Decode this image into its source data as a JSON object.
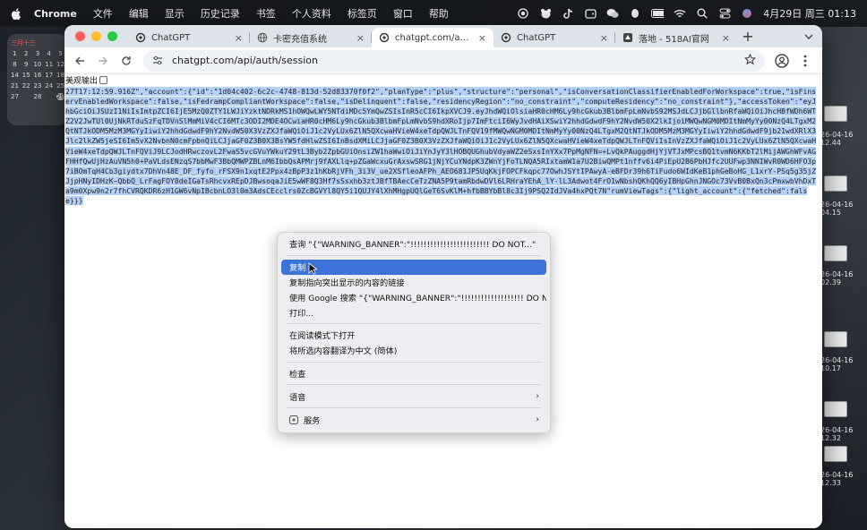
{
  "menubar": {
    "app": "Chrome",
    "items": [
      "文件",
      "编辑",
      "显示",
      "历史记录",
      "书签",
      "个人资料",
      "标签页",
      "窗口",
      "帮助"
    ],
    "clock": "4月29日 周三  01:13"
  },
  "calendar": {
    "header": "三月十三",
    "rows": [
      [
        "1",
        "2",
        "3",
        "4",
        "5"
      ],
      [
        "8",
        "9",
        "10",
        "11",
        "12"
      ],
      [
        "14",
        "15",
        "16",
        "17",
        "18"
      ],
      [
        "21",
        "22",
        "23",
        "24",
        "25"
      ],
      [
        "27",
        "28",
        "29"
      ]
    ],
    "today": "29"
  },
  "desktop": {
    "files": [
      "26-04-16\n12.44",
      "26-04-16\n04.15",
      "26-04-16\n02.39",
      "26-04-16\n10.17",
      "26-04-16\n12.32",
      "26-04-16\n12.33"
    ]
  },
  "browser": {
    "tabs": [
      {
        "title": "ChatGPT",
        "active": false
      },
      {
        "title": "卡密充值系统",
        "active": false
      },
      {
        "title": "chatgpt.com/api/auth/sess",
        "active": true
      },
      {
        "title": "ChatGPT",
        "active": false
      },
      {
        "title": "落地 - 518AI官网",
        "active": false
      }
    ],
    "url": "chatgpt.com/api/auth/session"
  },
  "page": {
    "pretty_print_label": "美观输出",
    "raw_json": "27T17:12:59.916Z\",\"account\":{\"id\":\"1d04c402-6c2c-4748-813d-52d83370f0f2\",\"planType\":\"plus\",\"structure\":\"personal\",\"isConversationClassifierEnabledForWorkspace\":true,\"isFinservEnabledWorkspace\":false,\"isFedrampCompliantWorkspace\":false,\"isDelinquent\":false,\"residencyRegion\":\"no_constraint\",\"computeResidency\":\"no_constraint\"},\"accessToken\":\"eyJhbGciOiJSUzI1NiIsImtpZCI6IjE5MzQ0ZTY1LWJiYzktNDRkMS1hOWQwLWY5NTdiMDc5YmQwZSIsInR5cCI6IkpXVCJ9.eyJhdWQiOlsiaHR0cHM6Ly9hcGkub3BlbmFpLmNvbS92MSJdLCJjbGllbnRfaWQiOiJhcHBfWDh6WTZ2V2JwTUl0UjNkRTduSzFqTDVnSlMmMiV4cCI6MTc3ODI2MDE4OCwiaHR0cHM6Ly9hcGkub3BlbmFpLmNvbS9hdXRoIjp7ImFtciI6WyJvdHAiXSwiY2hhdGdwdF9hY2NvdW50X2lkIjoiMWQwNGM0MDItNmMyYy00NzQ4LTgxM2QtNTJkODM5MzM3MGYyIiwiY2hhdGdwdF9hY2NvdW50X3VzZXJfaWQiOiJ1c2VyLUx6ZlN5QXcwaHVieW4xeTdpQWJLTnFQV19fMWQwNGM0MDItNmMyYy00NzQ4LTgxM2QtNTJkODM5MzM3MGYyIiwiY2hhdGdwdF9jb21wdXRlX3Jlc2lkZW5jeSI6Im5vX2NvbnN0cmFpbnQiLCJjaGF0Z3B0X3BsYW5fdHlwZSI6InBsdXMiLCJjaGF0Z3B0X3VzZXJfaWQiOiJ1c2VyLUx6ZlN5QXcwaHVieW4xeTdpQWJLTnFQViIsInVzZXJfaWQiOiJ1c2VyLUx6ZlN5QXcwaHVieW4xeTdpQWJLTnFQViJ9LCJodHRwczovL2FwaS5vcGVuYWkuY29tL3Byb2ZpbGUiOnsiZW1haWwiOiJiYnJyY3lHOBQUGhubVdyaWZ2eSxsInYXx7PpMgNFN=+LvQkPAuggdHjYjVTJxMPcsBQ1tvmN6KKbT2lMijAWGhWFvAGFHHfQwUjHzAuVN5h0+PaVLdsENzqS7bbMwF3BbQMWPZBLnM6IbbQsAPMrj9fAXLlq+pZGaWcxuGrAxswSRG1jNjYCuYNdpK3ZWnYjFoTLNQA5RIxtamW1a7U2BiwQMPt1nffv6i4PiEpU2B6PbHJfc2UUFwp3NNIWvR0WD6HFO3p7iBOmTqH4Cb3g",
    "raw_json_tail": "iydtx7DhVn48E_DF_fyfo_rFSX9n1xqtE2Ppx4zBpP3z1hKbRjVFh_3i3V_ue2XSfleoAFPh_AEO681JP5UqKkjFOPCFkqpc77OwhJSYtIPAwyA-eBFDr39h6TiFudo6WIdKeB1phGeBoHG_L1xrY-PSq5g35jZJjpHNyIDHzK~QbbQ_LrFagFOY8deIGaTsRhcvxREpDJBwsoqaJiE5wWF8Q3Hf7sSsxhb3ztJBfTBAecCeTzZNA5P9tamRbdwDVl6LRHraYEhA_lY-lL3Adwot4FrO1wNbshQKhQQ6yIBHpGhnJNGOc73VvB0BxQn3cPmxwbVhDxTa9m0Xpw9n2r7fhCVRQKDR6zH1GW6vNpIBcbnLO3l0m3AdsCEcclrs0ZcBGVYl8QY5i1QUJY4lXhMHgpUQlGeT6SvKlM+hfbBBYbBl8c3Ij9PSQ2IdJVa4hxPQt7N",
    "raw_end": "\"rumViewTags\":{\"light_account\":{\"fetched\":false}}}"
  },
  "context_menu": {
    "items": [
      {
        "label": "查询 \"{\"WARNING_BANNER\":\"!!!!!!!!!!!!!!!!!!!!!!!! DO NOT...\"",
        "selected": false,
        "submenu": false
      },
      {
        "sep": true
      },
      {
        "label": "复制",
        "selected": true,
        "submenu": false
      },
      {
        "label": "复制指向突出显示的内容的链接",
        "selected": false,
        "submenu": false
      },
      {
        "label": "使用 Google 搜索 \"{\"WARNING_BANNER\":\"!!!!!!!!!!!!!!!!!!! DO NOT...\"",
        "selected": false,
        "submenu": false
      },
      {
        "label": "打印...",
        "selected": false,
        "submenu": false
      },
      {
        "sep": true
      },
      {
        "label": "在阅读模式下打开",
        "selected": false,
        "submenu": false
      },
      {
        "label": "将所选内容翻译为中文 (简体)",
        "selected": false,
        "submenu": false
      },
      {
        "sep": true
      },
      {
        "label": "检查",
        "selected": false,
        "submenu": false
      },
      {
        "sep": true
      },
      {
        "label": "语音",
        "selected": false,
        "submenu": true
      },
      {
        "sep": true
      },
      {
        "label": "服务",
        "selected": false,
        "submenu": true,
        "icon": true
      }
    ]
  }
}
